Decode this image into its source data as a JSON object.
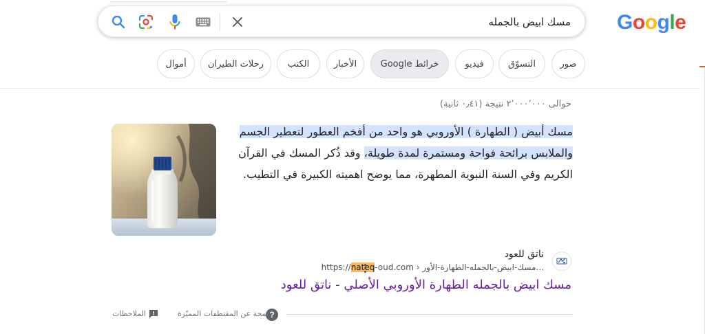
{
  "logo": {
    "letters": [
      {
        "ch": "G",
        "color": "#4285f4"
      },
      {
        "ch": "o",
        "color": "#ea4335"
      },
      {
        "ch": "o",
        "color": "#fbbc05"
      },
      {
        "ch": "g",
        "color": "#4285f4"
      },
      {
        "ch": "l",
        "color": "#34a853"
      },
      {
        "ch": "e",
        "color": "#ea4335"
      }
    ]
  },
  "search": {
    "query": "مسك ابيض بالجمله",
    "icons": {
      "clear": "close-icon",
      "keyboard": "keyboard-icon",
      "voice": "mic-icon",
      "lens": "lens-icon",
      "search": "search-icon"
    }
  },
  "chips": [
    {
      "label": "صور",
      "selected": false
    },
    {
      "label": "التسوّق",
      "selected": false
    },
    {
      "label": "فيديو",
      "selected": false
    },
    {
      "label": "خرائط Google",
      "selected": true
    },
    {
      "label": "الأخبار",
      "selected": false
    },
    {
      "label": "الكتب",
      "selected": false
    },
    {
      "label": "رحلات الطيران",
      "selected": false
    },
    {
      "label": "أموال",
      "selected": false
    }
  ],
  "result_stats": "حوالى ٢٬٠٠٠٬٠٠٠ نتيجة (٠٫٤١ ثانية)",
  "featured_snippet": {
    "highlighted_text": "مسك أبيض ( الطهارة ) الأوروبي هو واحد من أفخم العطور لتعطير الجسم والملابس برائحة فواحة ومستمرة لمدة طويلة،",
    "rest_text": " وقد ذُكر المسك في القرآن الكريم وفي السنة النبوية المطهرة، مما يوضح اهميته الكبيرة في التطيب.",
    "image_alt": "milk-bottle-image"
  },
  "source": {
    "site_name": "ناتق للعود",
    "url_prefix": "https://",
    "url_highlight": "nateq",
    "url_domain": "-oud.com",
    "url_path": " › مسك-ابيض-بالجمله-الطهارة-الأور...",
    "title": "مسك ابيض بالجمله الطهارة الأوروبي الأصلي - ناتق للعود"
  },
  "footer": {
    "about_label": "لمحة عن المقتطفات المميّزة",
    "feedback_label": "الملاحظات"
  },
  "colors": {
    "highlight": "#d3e3fd",
    "url_mark": "#f8b95e",
    "visited_link": "#681da8",
    "selected_chip": "#eaebee"
  }
}
